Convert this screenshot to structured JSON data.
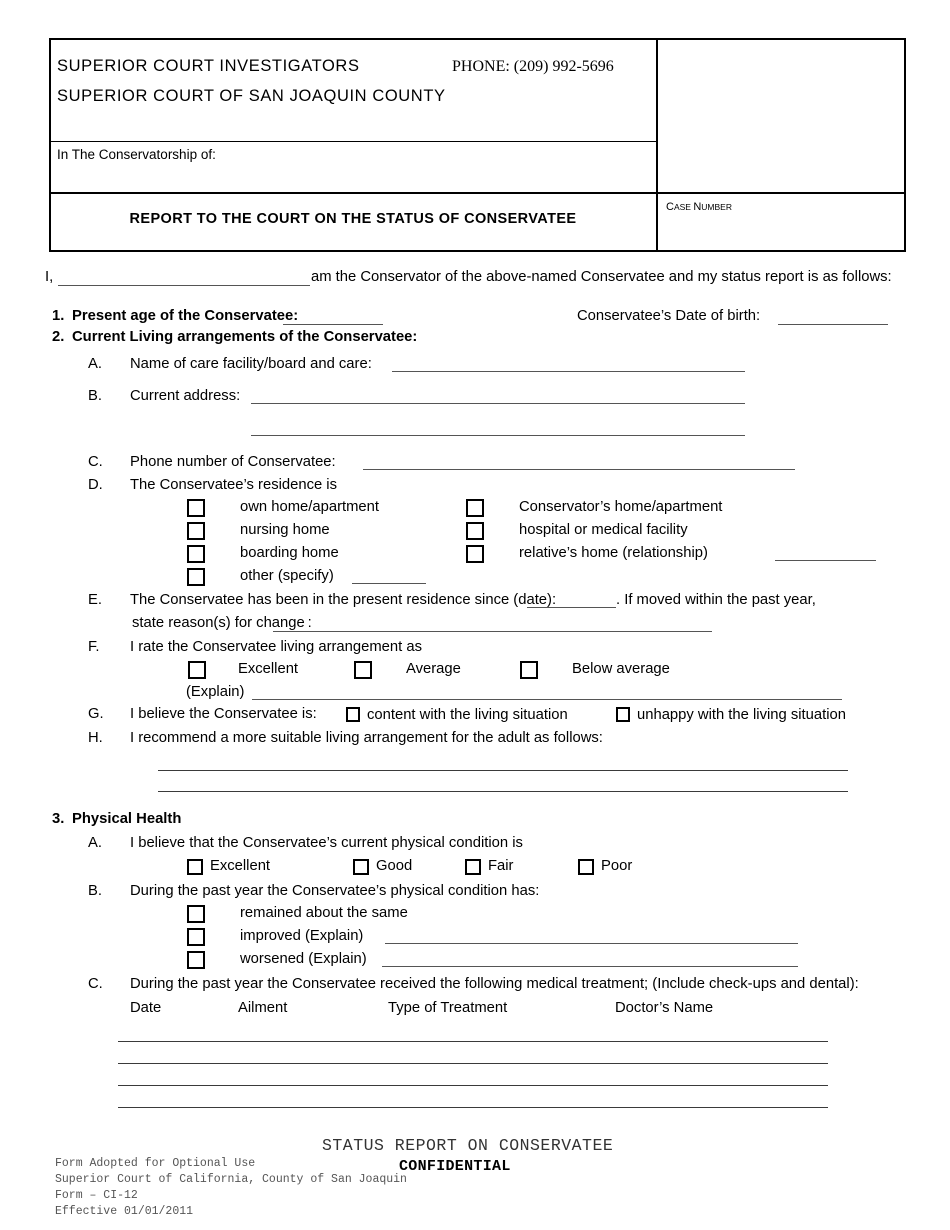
{
  "header": {
    "court_investigators": "SUPERIOR COURT INVESTIGATORS",
    "phone": "PHONE: (209) 992-5696",
    "court_name": "SUPERIOR COURT OF SAN JOAQUIN COUNTY",
    "in_the_conservatorship_of": "In The Conservatorship of:",
    "report_title": "REPORT TO THE COURT ON THE STATUS OF CONSERVATEE",
    "case_number_label_first": "C",
    "case_number_label_rest1": "ASE ",
    "case_number_label_n": "N",
    "case_number_label_rest2": "UMBER"
  },
  "intro": {
    "prefix": "I,",
    "suffix": "am the Conservator of the above-named Conservatee and my status report is as follows:"
  },
  "item1": {
    "number": "1.",
    "label": "Present age of the Conservatee:",
    "dob_label": "Conservatee’s Date of birth:"
  },
  "item2": {
    "number": "2.",
    "label": "Current Living arrangements of the Conservatee:",
    "a": {
      "letter": "A.",
      "label": "Name of care facility/board and care:"
    },
    "b": {
      "letter": "B.",
      "label": "Current address:"
    },
    "c": {
      "letter": "C.",
      "label": "Phone number of Conservatee:"
    },
    "d": {
      "letter": "D.",
      "label": "The Conservatee’s residence is",
      "options_left": [
        "own home/apartment",
        "nursing home",
        "boarding home",
        "other (specify)"
      ],
      "options_right": [
        "Conservator’s  home/apartment",
        "hospital or medical facility",
        "relative’s home (relationship)"
      ]
    },
    "e": {
      "letter": "E.",
      "line1a": "The Conservatee has been in the present residence since (date):",
      "line1b": ".  If moved within the past year,",
      "line2": "state reason(s) for change :"
    },
    "f": {
      "letter": "F.",
      "label": "I rate the Conservatee living arrangement as",
      "options": [
        "Excellent",
        "Average",
        "Below average"
      ],
      "explain": "(Explain)"
    },
    "g": {
      "letter": "G.",
      "label": "I believe the Conservatee is:",
      "option1": "content with the living situation",
      "option2": "unhappy with the living situation"
    },
    "h": {
      "letter": "H.",
      "label": "I recommend a more suitable living arrangement for the adult as follows:"
    }
  },
  "item3": {
    "number": "3.",
    "label": "Physical Health",
    "a": {
      "letter": "A.",
      "label": "I believe that the Conservatee’s current physical condition is",
      "options": [
        "Excellent",
        "Good",
        "Fair",
        "Poor"
      ]
    },
    "b": {
      "letter": "B.",
      "label": "During the past year the Conservatee’s physical condition has:",
      "options": [
        "remained about the same",
        "improved (Explain)",
        "worsened (Explain)"
      ]
    },
    "c": {
      "letter": "C.",
      "label": "During the past year the Conservatee received the following medical treatment; (Include check-ups and dental):",
      "columns": [
        "Date",
        "Ailment",
        "Type of Treatment",
        "Doctor’s Name"
      ]
    }
  },
  "footer": {
    "title": "STATUS REPORT ON CONSERVATEE",
    "confidential": "CONFIDENTIAL",
    "line1": "Form Adopted for Optional Use",
    "line2": "Superior Court of California, County of San Joaquin",
    "line3": "Form – CI-12",
    "line4": "Effective 01/01/2011"
  }
}
